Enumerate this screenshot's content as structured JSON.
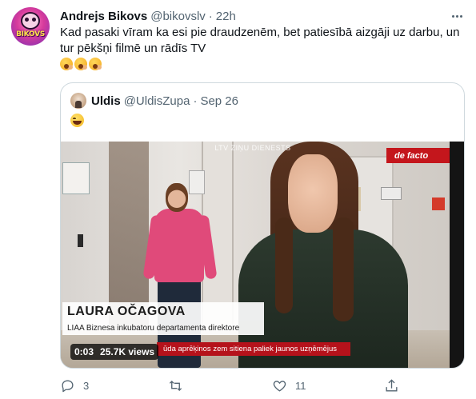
{
  "tweet": {
    "author_name": "Andrejs Bikovs",
    "author_handle": "@bikovslv",
    "separator": "·",
    "timestamp": "22h",
    "avatar_text": "BIKOVS",
    "text": "Kad pasaki vīram ka esi pie draudzenēm, bet patiesībā aizgāji uz darbu, un tur pēkšņi filmē un rādīs TV",
    "emojis": [
      "yawning-face",
      "yawning-face",
      "yawning-face"
    ],
    "more_label": "More"
  },
  "quoted": {
    "author_name": "Uldis",
    "author_handle": "@UldisZupa",
    "separator": "·",
    "timestamp": "Sep 26",
    "emoji": "grinning-face"
  },
  "video": {
    "channel_bug": "LTV ZIŅU DIENESTS",
    "show_logo": "de facto",
    "lower_third_name": "LAURA OČAGOVA",
    "lower_third_role": "LIAA Biznesa inkubatoru departamenta direktore",
    "ticker": "ūda aprēķinos zem sitiena paliek jaunos uzņēmējus",
    "duration": "0:03",
    "views": "25.7K views"
  },
  "actions": {
    "reply_count": "3",
    "retweet_count": "",
    "like_count": "11",
    "share_count": ""
  },
  "colors": {
    "text_primary": "#0f1419",
    "text_secondary": "#536471",
    "border": "#cfd9de",
    "defacto_red": "#c4161c",
    "ticker_red": "#b5121b"
  }
}
